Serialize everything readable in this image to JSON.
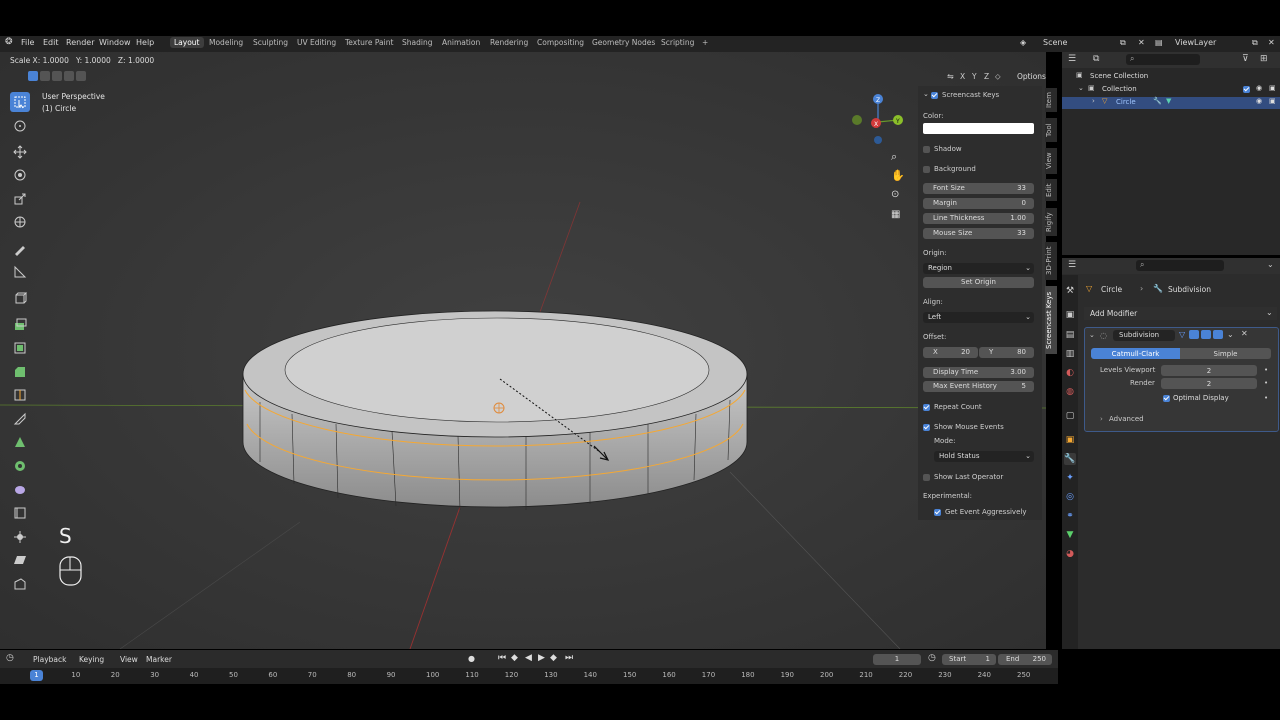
{
  "menu": {
    "items": [
      "File",
      "Edit",
      "Render",
      "Window",
      "Help"
    ],
    "workspaces": [
      "Layout",
      "Modeling",
      "Sculpting",
      "UV Editing",
      "Texture Paint",
      "Shading",
      "Animation",
      "Rendering",
      "Compositing",
      "Geometry Nodes",
      "Scripting"
    ],
    "add_tab": "+",
    "scene": "Scene",
    "view_layer": "ViewLayer"
  },
  "viewport": {
    "transform_status": "Scale X: 1.0000   Y: 1.0000   Z: 1.0000",
    "perspective": "User Perspective",
    "object_label": "(1) Circle",
    "xyz_labels": [
      "X",
      "Y",
      "Z"
    ],
    "options_label": "Options",
    "key_overlay": "S"
  },
  "screencast": {
    "title": "Screencast Keys",
    "color_label": "Color:",
    "shadow": "Shadow",
    "background": "Background",
    "font_size": {
      "label": "Font Size",
      "value": "33"
    },
    "margin": {
      "label": "Margin",
      "value": "0"
    },
    "line_thickness": {
      "label": "Line Thickness",
      "value": "1.00"
    },
    "mouse_size": {
      "label": "Mouse Size",
      "value": "33"
    },
    "origin_label": "Origin:",
    "origin_value": "Region",
    "set_origin": "Set Origin",
    "align_label": "Align:",
    "align_value": "Left",
    "offset_label": "Offset:",
    "offset_x": {
      "label": "X",
      "value": "20"
    },
    "offset_y": {
      "label": "Y",
      "value": "80"
    },
    "display_time": {
      "label": "Display Time",
      "value": "3.00"
    },
    "max_event_history": {
      "label": "Max Event History",
      "value": "5"
    },
    "repeat_count": "Repeat Count",
    "show_mouse_events": "Show Mouse Events",
    "mode_label": "Mode:",
    "mode_value": "Hold Status",
    "show_last_operator": "Show Last Operator",
    "experimental_label": "Experimental:",
    "get_event_aggressively": "Get Event Aggressively"
  },
  "side_tabs": [
    "Item",
    "Tool",
    "View",
    "Edit",
    "Rigify",
    "3D-Print",
    "Screencast Keys"
  ],
  "outliner": {
    "scene_collection": "Scene Collection",
    "collection": "Collection",
    "object": "Circle"
  },
  "properties": {
    "breadcrumb_object": "Circle",
    "breadcrumb_modifier": "Subdivision",
    "add_modifier": "Add Modifier",
    "modifier_name": "Subdivision",
    "catmull_clark": "Catmull-Clark",
    "simple": "Simple",
    "levels_viewport": {
      "label": "Levels Viewport",
      "value": "2"
    },
    "render": {
      "label": "Render",
      "value": "2"
    },
    "optimal_display": "Optimal Display",
    "advanced": "Advanced"
  },
  "timeline": {
    "playback": "Playback",
    "keying": "Keying",
    "view": "View",
    "marker": "Marker",
    "current_frame": "1",
    "start": {
      "label": "Start",
      "value": "1"
    },
    "end": {
      "label": "End",
      "value": "250"
    },
    "ticks": [
      "10",
      "20",
      "30",
      "40",
      "50",
      "60",
      "70",
      "80",
      "90",
      "100",
      "110",
      "120",
      "130",
      "140",
      "150",
      "160",
      "170",
      "180",
      "190",
      "200",
      "210",
      "220",
      "230",
      "240",
      "250"
    ],
    "playhead": "1"
  },
  "colors": {
    "accent": "#4a83d6",
    "selection": "#f5a833",
    "x_axis": "#b03030",
    "y_axis": "#6a9a2a"
  }
}
